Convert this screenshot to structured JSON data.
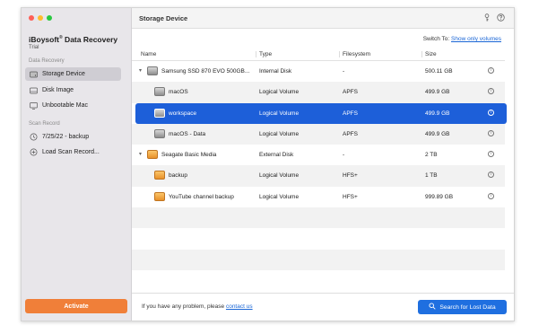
{
  "app": {
    "title": "iBoysoft",
    "title_sup": "®",
    "title_rest": " Data Recovery",
    "edition": "Trial"
  },
  "sidebar": {
    "section_data_recovery": "Data Recovery",
    "items": [
      {
        "label": "Storage Device",
        "icon": "hard-drive-icon",
        "active": true
      },
      {
        "label": "Disk Image",
        "icon": "disk-image-icon",
        "active": false
      },
      {
        "label": "Unbootable Mac",
        "icon": "mac-icon",
        "active": false
      }
    ],
    "section_scan_record": "Scan Record",
    "records": [
      {
        "label": "7/25/22 - backup",
        "icon": "history-icon"
      },
      {
        "label": "Load Scan Record...",
        "icon": "add-circle-icon"
      }
    ],
    "activate_label": "Activate"
  },
  "header": {
    "title": "Storage Device",
    "icons": [
      "key-icon",
      "help-icon"
    ]
  },
  "switch_to": {
    "label": "Switch To: ",
    "link": "Show only volumes"
  },
  "table": {
    "columns": [
      "Name",
      "Type",
      "Filesystem",
      "Size"
    ],
    "rows": [
      {
        "name": "Samsung SSD 870 EVO 500GB...",
        "type": "Internal Disk",
        "fs": "-",
        "size": "500.11 GB",
        "level": 0,
        "icon": "drive-gray",
        "expanded": true
      },
      {
        "name": "macOS",
        "type": "Logical Volume",
        "fs": "APFS",
        "size": "499.9 GB",
        "level": 1,
        "icon": "drive-gray"
      },
      {
        "name": "workspace",
        "type": "Logical Volume",
        "fs": "APFS",
        "size": "499.9 GB",
        "level": 1,
        "icon": "drive-gray",
        "selected": true
      },
      {
        "name": "macOS - Data",
        "type": "Logical Volume",
        "fs": "APFS",
        "size": "499.9 GB",
        "level": 1,
        "icon": "drive-gray"
      },
      {
        "name": "Seagate Basic Media",
        "type": "External Disk",
        "fs": "-",
        "size": "2 TB",
        "level": 0,
        "icon": "drive-orange",
        "expanded": true
      },
      {
        "name": "backup",
        "type": "Logical Volume",
        "fs": "HFS+",
        "size": "1 TB",
        "level": 1,
        "icon": "drive-orange"
      },
      {
        "name": "YouTube channel backup",
        "type": "Logical Volume",
        "fs": "HFS+",
        "size": "999.89 GB",
        "level": 1,
        "icon": "drive-orange"
      }
    ]
  },
  "footer": {
    "help_text": "If you have any problem, please ",
    "help_link": "contact us",
    "search_label": "Search for Lost Data"
  },
  "colors": {
    "accent": "#1d5fd9",
    "activate": "#f07f39"
  }
}
